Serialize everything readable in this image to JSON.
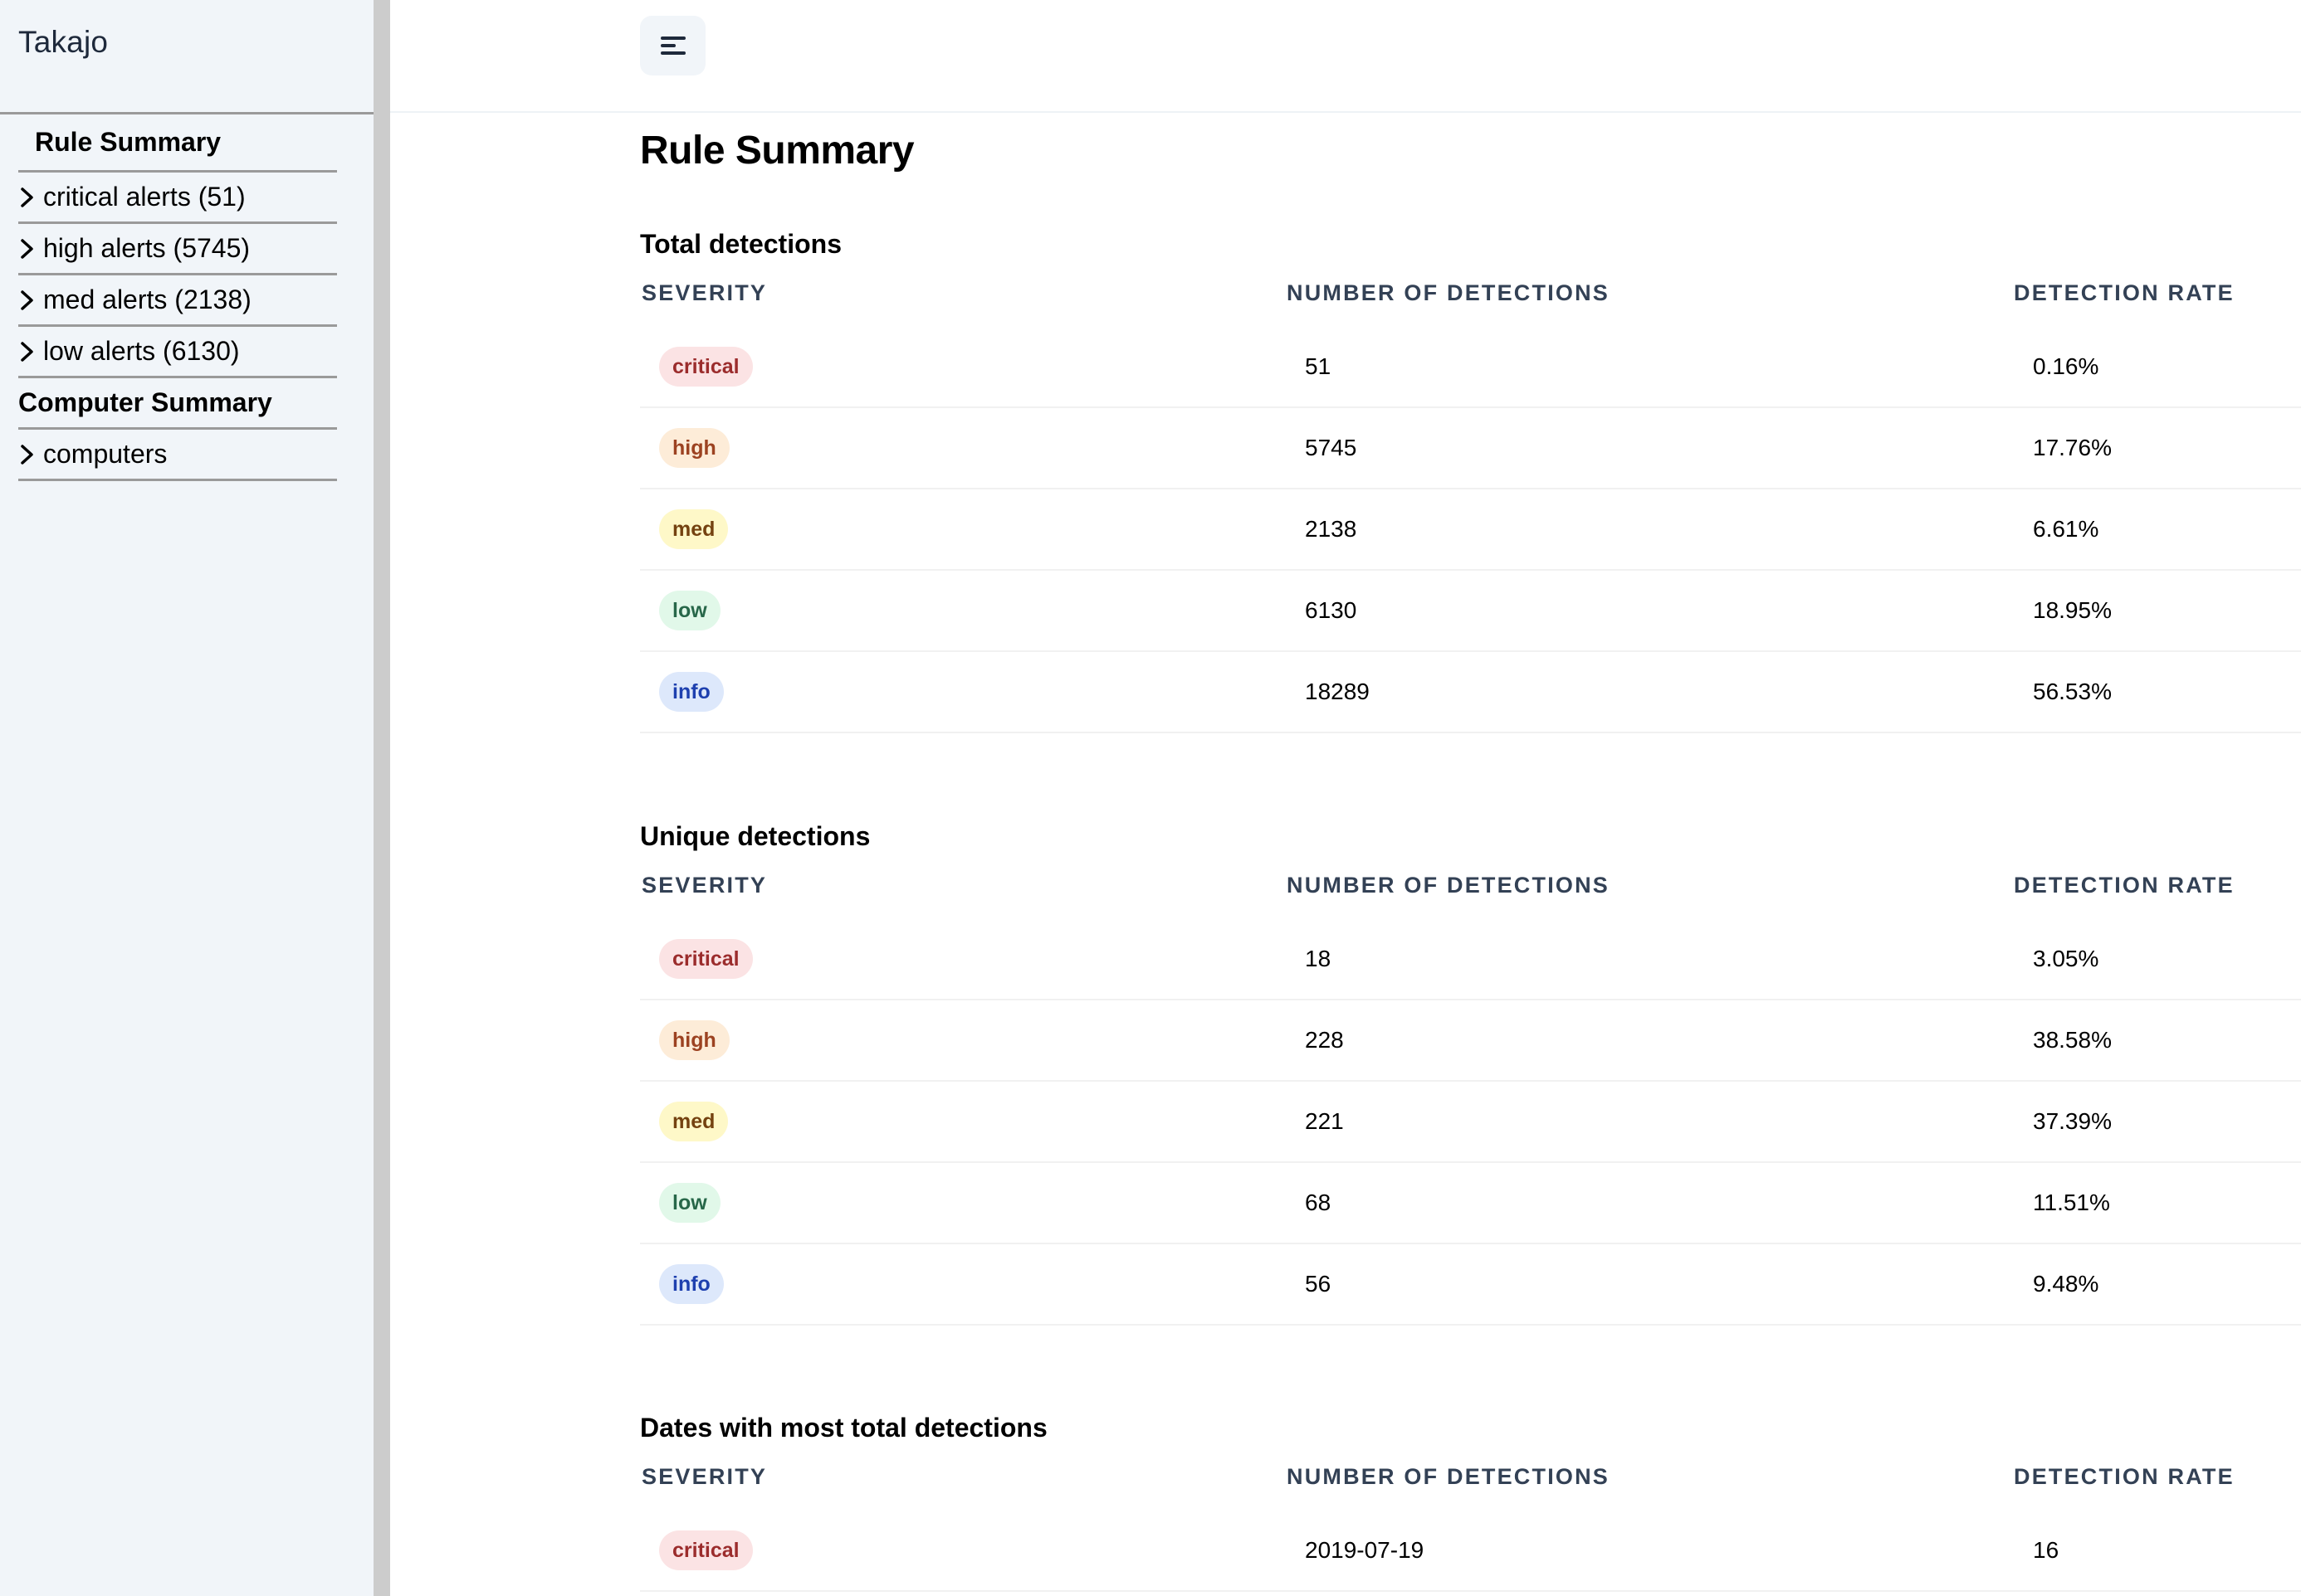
{
  "app": {
    "title": "Takajo"
  },
  "sidebar": {
    "items": [
      {
        "label": "Rule Summary",
        "type": "heading",
        "indent": true
      },
      {
        "label": "critical alerts (51)",
        "type": "expandable"
      },
      {
        "label": "high alerts (5745)",
        "type": "expandable"
      },
      {
        "label": "med alerts (2138)",
        "type": "expandable"
      },
      {
        "label": "low alerts (6130)",
        "type": "expandable"
      },
      {
        "label": "Computer Summary",
        "type": "heading"
      },
      {
        "label": "computers",
        "type": "expandable"
      }
    ]
  },
  "toolbar": {
    "menu_icon": "menu-icon"
  },
  "page": {
    "title": "Rule Summary"
  },
  "colors": {
    "sidebar_bg": "#f1f5f9",
    "header_text": "#334155",
    "critical": {
      "bg": "#fbe3e4",
      "fg": "#9b2c2c"
    },
    "high": {
      "bg": "#fdecd8",
      "fg": "#9c4221"
    },
    "med": {
      "bg": "#fef8c8",
      "fg": "#744210"
    },
    "low": {
      "bg": "#e1f8e9",
      "fg": "#276749"
    },
    "info": {
      "bg": "#dde8fb",
      "fg": "#1e40af"
    }
  },
  "sections": [
    {
      "title": "Total detections",
      "columns": [
        "SEVERITY",
        "NUMBER OF DETECTIONS",
        "DETECTION RATE"
      ],
      "rows": [
        {
          "severity": "critical",
          "value": "51",
          "rate": "0.16%"
        },
        {
          "severity": "high",
          "value": "5745",
          "rate": "17.76%"
        },
        {
          "severity": "med",
          "value": "2138",
          "rate": "6.61%"
        },
        {
          "severity": "low",
          "value": "6130",
          "rate": "18.95%"
        },
        {
          "severity": "info",
          "value": "18289",
          "rate": "56.53%"
        }
      ]
    },
    {
      "title": "Unique detections",
      "columns": [
        "SEVERITY",
        "NUMBER OF DETECTIONS",
        "DETECTION RATE"
      ],
      "rows": [
        {
          "severity": "critical",
          "value": "18",
          "rate": "3.05%"
        },
        {
          "severity": "high",
          "value": "228",
          "rate": "38.58%"
        },
        {
          "severity": "med",
          "value": "221",
          "rate": "37.39%"
        },
        {
          "severity": "low",
          "value": "68",
          "rate": "11.51%"
        },
        {
          "severity": "info",
          "value": "56",
          "rate": "9.48%"
        }
      ]
    },
    {
      "title": "Dates with most total detections",
      "columns": [
        "SEVERITY",
        "NUMBER OF DETECTIONS",
        "DETECTION RATE"
      ],
      "rows": [
        {
          "severity": "critical",
          "value": "2019-07-19",
          "rate": "16"
        }
      ]
    }
  ]
}
